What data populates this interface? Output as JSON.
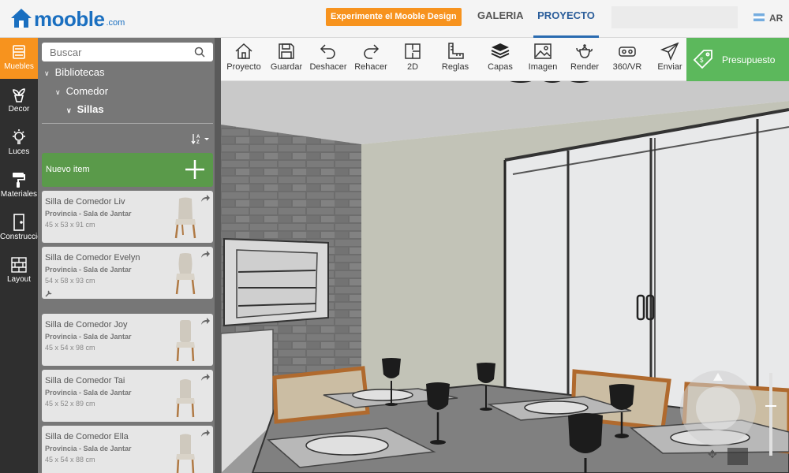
{
  "header": {
    "logo": "mooble",
    "logo_suffix": ".com",
    "cta_label": "Experimente el Mooble Design",
    "nav": [
      "GALERIA",
      "PROYECTO"
    ],
    "lang": "AR"
  },
  "categories": [
    {
      "label": "Muebles",
      "icon": "sofa-icon",
      "active": true
    },
    {
      "label": "Decor",
      "icon": "plant-icon"
    },
    {
      "label": "Luces",
      "icon": "lightbulb-icon"
    },
    {
      "label": "Materiales",
      "icon": "paint-roller-icon"
    },
    {
      "label": "Construcción",
      "icon": "door-icon"
    },
    {
      "label": "Layout",
      "icon": "brick-grid-icon"
    }
  ],
  "library": {
    "search_placeholder": "Buscar",
    "tree": [
      "Bibliotecas",
      "Comedor",
      "Sillas"
    ],
    "sort_label": "A Z",
    "new_item_label": "Nuevo item",
    "items": [
      {
        "name": "Silla de Comedor Liv",
        "subtitle": "Provincia - Sala de Jantar",
        "dims": "45 x 53 x 91 cm"
      },
      {
        "name": "Silla de Comedor Evelyn",
        "subtitle": "Provincia - Sala de Jantar",
        "dims": "54 x 58 x 93 cm"
      },
      {
        "name": "Silla de Comedor Joy",
        "subtitle": "Provincia - Sala de Jantar",
        "dims": "45 x 54 x 98 cm"
      },
      {
        "name": "Silla de Comedor Tai",
        "subtitle": "Provincia - Sala de Jantar",
        "dims": "45 x 52 x 89 cm"
      },
      {
        "name": "Silla de Comedor Ella",
        "subtitle": "Provincia - Sala de Jantar",
        "dims": "45 x 54 x 88 cm"
      }
    ]
  },
  "toolbar": {
    "tools": [
      {
        "label": "Proyecto",
        "icon": "house-icon"
      },
      {
        "label": "Guardar",
        "icon": "floppy-disk-icon"
      },
      {
        "label": "Deshacer",
        "icon": "undo-icon"
      },
      {
        "label": "Rehacer",
        "icon": "redo-icon"
      },
      {
        "label": "2D",
        "icon": "floorplan-icon"
      },
      {
        "label": "Reglas",
        "icon": "ruler-icon"
      },
      {
        "label": "Capas",
        "icon": "layers-icon"
      },
      {
        "label": "Imagen",
        "icon": "image-icon"
      },
      {
        "label": "Render",
        "icon": "teapot-icon"
      },
      {
        "label": "360/VR",
        "icon": "vr-headset-icon"
      },
      {
        "label": "Enviar",
        "icon": "send-icon"
      }
    ],
    "budget_label": "Presupuesto"
  },
  "colors": {
    "brand_blue": "#1a6fc0",
    "accent_orange": "#f7931e",
    "budget_green": "#5cb85c",
    "new_item_green": "#5a9a4a"
  }
}
